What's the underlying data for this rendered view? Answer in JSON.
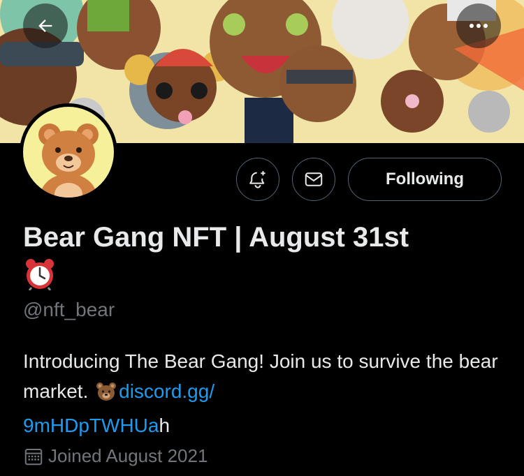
{
  "profile": {
    "name": "Bear Gang NFT | August 31st",
    "handle": "@nft_bear",
    "bio": {
      "text_before": "Introducing The Bear Gang! Join us to survive the bear market. ",
      "link_line1": "discord.gg/",
      "link_line2": "9mHDpTWHUa",
      "trailing": "h"
    },
    "joined": "Joined August 2021"
  },
  "actions": {
    "following_label": "Following"
  },
  "icons": {
    "back": "arrow-left-icon",
    "more": "more-dots-icon",
    "notify": "bell-plus-icon",
    "message": "envelope-icon",
    "calendar": "calendar-icon",
    "alarm": "alarm-clock-emoji",
    "bear": "bear-emoji"
  },
  "colors": {
    "background": "#000000",
    "text": "#e7e9ea",
    "muted": "#71767b",
    "link": "#1d9bf0",
    "border": "#536471"
  }
}
